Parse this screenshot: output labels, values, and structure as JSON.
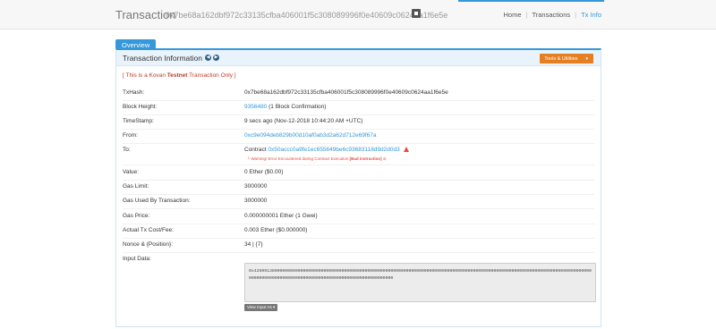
{
  "header": {
    "title": "Transaction",
    "tx_hash": "0x7be68a162dbf972c33135cfba406001f5c308089996f0e40609c0624aa1f6e5e",
    "breadcrumbs": [
      "Home",
      "Transactions",
      "Tx Info"
    ]
  },
  "tabs": [
    {
      "label": "Overview"
    }
  ],
  "panel": {
    "title": "Transaction Information",
    "tools_label": "Tools & Utilities",
    "kovan_prefix": "[ This is a Kovan ",
    "kovan_bold": "Testnet",
    "kovan_suffix": " Transaction Only ]"
  },
  "fields": {
    "txhash_label": "TxHash:",
    "txhash": "0x7be68a162dbf972c33135cfba406001f5c308089996f0e40609c0624aa1f6e5e",
    "block_label": "Block Height:",
    "block_number": "9356480",
    "block_conf": " (1 Block Confirmation)",
    "timestamp_label": "TimeStamp:",
    "timestamp": "9 secs ago (Nov-12-2018 10:44:20 AM +UTC)",
    "from_label": "From:",
    "from": "0xc9e094deb829b00d10af0ab3d2a62d712e69f67a",
    "to_label": "To:",
    "to_prefix": "Contract ",
    "to_address": "0x50accc0a9fe1ec655649be6c93683118d9d2d0d3",
    "warning_prefix": "└ Warning! Error Encountered during Contract Execution ",
    "warning_bold": "[Bad instruction]",
    "value_label": "Value:",
    "value": "0 Ether ($0.00)",
    "gas_limit_label": "Gas Limit:",
    "gas_limit": "3000000",
    "gas_used_label": "Gas Used By Transaction:",
    "gas_used": "3000000",
    "gas_price_label": "Gas Price:",
    "gas_price": "0.000000001 Ether (1 Gwei)",
    "tx_cost_label": "Actual Tx Cost/Fee:",
    "tx_cost": "0.003 Ether ($0.000000)",
    "nonce_label": "Nonce & {Position}:",
    "nonce": "34 | {7}",
    "input_label": "Input Data:",
    "input_data": "0x4250913800000000000000000000000000000000000000000000000000000000000000000000000000000000000000000000000000000000000000000000000000000000000000000000000000000000000000000000000000000000000",
    "view_input_label": "View Input As ▾"
  },
  "colors": {
    "accent": "#3498db",
    "warning": "#e74c3c",
    "tools": "#e67e22"
  }
}
